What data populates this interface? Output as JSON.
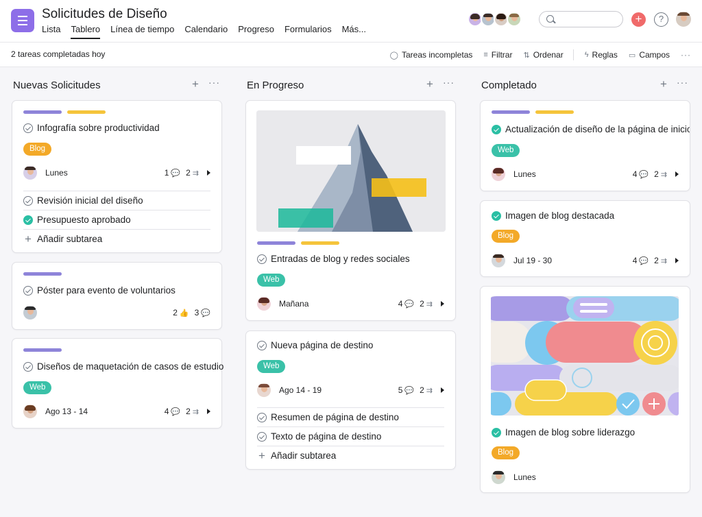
{
  "header": {
    "title": "Solicitudes de Diseño",
    "tabs": [
      "Lista",
      "Tablero",
      "Línea de tiempo",
      "Calendario",
      "Progreso",
      "Formularios",
      "Más..."
    ],
    "active_tab": "Tablero",
    "search_placeholder": ""
  },
  "subbar": {
    "completed": "2 tareas completadas hoy",
    "incomplete": "Tareas incompletas",
    "filter": "Filtrar",
    "sort": "Ordenar",
    "rules": "Reglas",
    "fields": "Campos"
  },
  "columns": [
    {
      "title": "Nuevas Solicitudes"
    },
    {
      "title": "En Progreso"
    },
    {
      "title": "Completado"
    }
  ],
  "cards": {
    "c1": {
      "title": "Infografía sobre productividad",
      "tag": "Blog",
      "date": "Lunes",
      "comments": "1",
      "subtasks": "2",
      "subs": [
        "Revisión inicial del diseño",
        "Presupuesto aprobado"
      ],
      "add": "Añadir subtarea"
    },
    "c2": {
      "title": "Póster para evento de voluntarios",
      "likes": "2",
      "comments": "3"
    },
    "c3": {
      "title": "Diseños de maquetación de casos de estudio",
      "tag": "Web",
      "date": "Ago 13 - 14",
      "comments": "4",
      "subtasks": "2"
    },
    "c4": {
      "title": "Entradas de blog y redes sociales",
      "tag": "Web",
      "date": "Mañana",
      "comments": "4",
      "subtasks": "2"
    },
    "c5": {
      "title": "Nueva página de destino",
      "tag": "Web",
      "date": "Ago 14 - 19",
      "comments": "5",
      "subtasks": "2",
      "subs": [
        "Resumen de página de destino",
        "Texto de página de destino"
      ],
      "add": "Añadir subtarea"
    },
    "c6": {
      "title": "Actualización de diseño de la página de inicio",
      "tag": "Web",
      "date": "Lunes",
      "comments": "4",
      "subtasks": "2"
    },
    "c7": {
      "title": "Imagen de blog destacada",
      "tag": "Blog",
      "date": "Jul 19 - 30",
      "comments": "4",
      "subtasks": "2"
    },
    "c8": {
      "title": "Imagen de blog sobre liderazgo",
      "tag": "Blog",
      "date": "Lunes"
    }
  },
  "colors": {
    "accent": "#8d6ee8",
    "blog": "#f3a928",
    "web": "#3ac1a8",
    "plus": "#f06a6a"
  }
}
